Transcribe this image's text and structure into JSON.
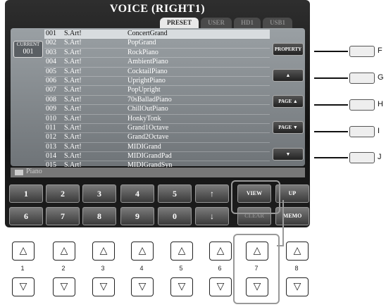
{
  "screen": {
    "title": "VOICE (RIGHT1)",
    "tabs": [
      {
        "label": "PRESET",
        "active": true
      },
      {
        "label": "USER",
        "active": false
      },
      {
        "label": "HD1",
        "active": false
      },
      {
        "label": "USB1",
        "active": false
      }
    ],
    "current": {
      "label": "CURRENT",
      "number": "001"
    },
    "voices": [
      {
        "num": "001",
        "cat": "S.Art!",
        "name": "ConcertGrand",
        "selected": true
      },
      {
        "num": "002",
        "cat": "S.Art!",
        "name": "PopGrand"
      },
      {
        "num": "003",
        "cat": "S.Art!",
        "name": "RockPiano"
      },
      {
        "num": "004",
        "cat": "S.Art!",
        "name": "AmbientPiano"
      },
      {
        "num": "005",
        "cat": "S.Art!",
        "name": "CocktailPiano"
      },
      {
        "num": "006",
        "cat": "S.Art!",
        "name": "UprightPiano"
      },
      {
        "num": "007",
        "cat": "S.Art!",
        "name": "PopUpright"
      },
      {
        "num": "008",
        "cat": "S.Art!",
        "name": "70sBalladPiano"
      },
      {
        "num": "009",
        "cat": "S.Art!",
        "name": "ChillOutPiano"
      },
      {
        "num": "010",
        "cat": "S.Art!",
        "name": "HonkyTonk"
      },
      {
        "num": "011",
        "cat": "S.Art!",
        "name": "Grand1Octave"
      },
      {
        "num": "012",
        "cat": "S.Art!",
        "name": "Grand2Octave"
      },
      {
        "num": "013",
        "cat": "S.Art!",
        "name": "MIDIGrand"
      },
      {
        "num": "014",
        "cat": "S.Art!",
        "name": "MIDIGrandPad"
      },
      {
        "num": "015",
        "cat": "S.Art!",
        "name": "MIDIGrandSyn"
      }
    ],
    "right_buttons": {
      "property": "PROPERTY",
      "top": "▲",
      "page_up": "PAGE ▲",
      "page_down": "PAGE ▼",
      "bottom": "▼"
    },
    "folder": "Piano",
    "keypad_row1": [
      "1",
      "2",
      "3",
      "4",
      "5",
      "↑"
    ],
    "keypad_row2": [
      "6",
      "7",
      "8",
      "9",
      "0",
      "↓"
    ],
    "view_label": "VIEW",
    "up_label": "UP",
    "clear_label": "CLEAR",
    "memo_label": "MEMO"
  },
  "external_labels": [
    "F",
    "G",
    "H",
    "I",
    "J"
  ],
  "panel_numbers": [
    "1",
    "2",
    "3",
    "4",
    "5",
    "6",
    "7",
    "8"
  ],
  "up_glyph": "△",
  "down_glyph": "▽"
}
